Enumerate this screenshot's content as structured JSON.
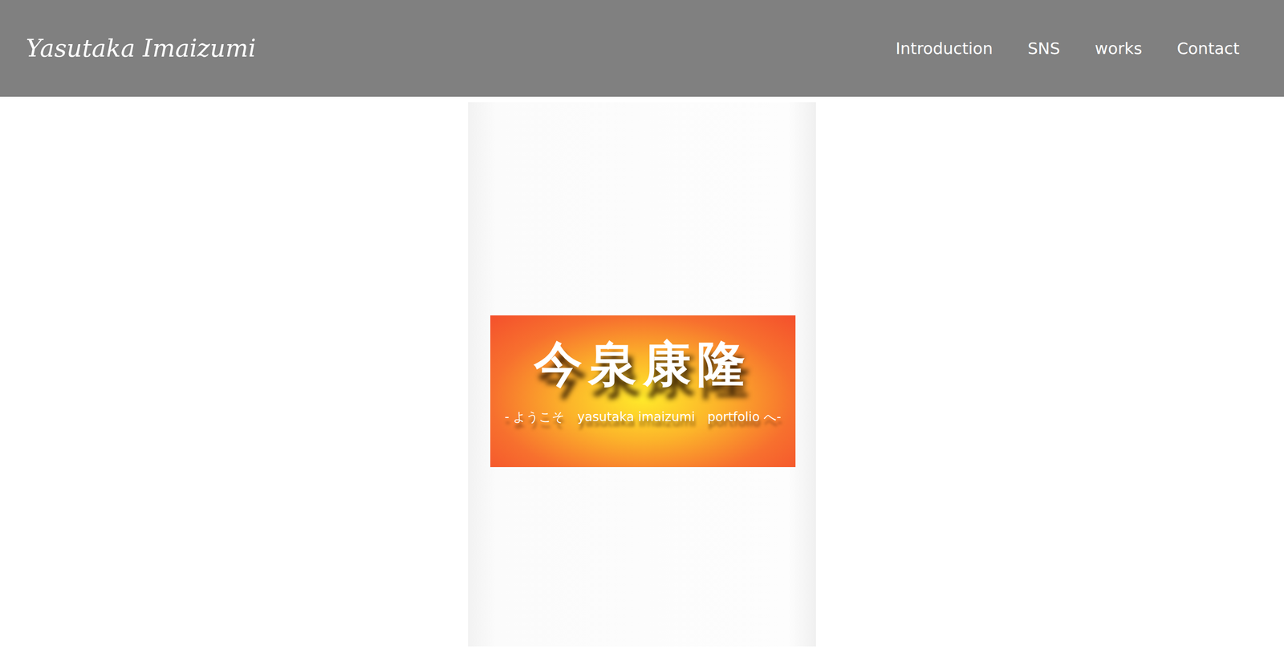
{
  "header": {
    "logo": "Yasutaka Imaizumi",
    "nav": [
      "Introduction",
      "SNS",
      "works",
      "Contact"
    ]
  },
  "hero": {
    "title": "今泉康隆",
    "subtitle": "- ようこそ　yasutaka imaizumi　portfolio へ-"
  }
}
